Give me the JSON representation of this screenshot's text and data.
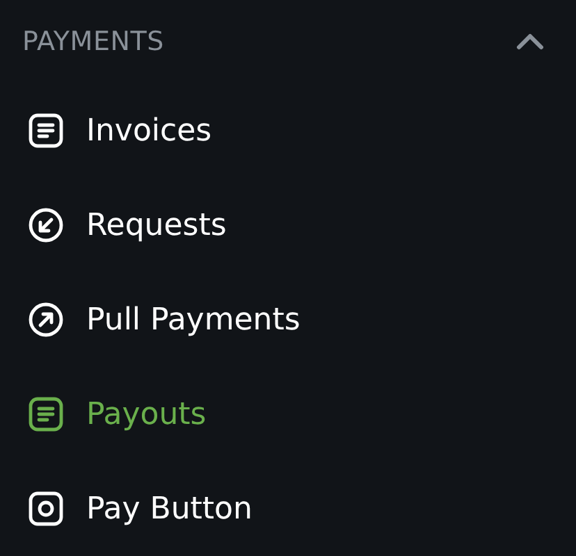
{
  "section": {
    "title": "PAYMENTS",
    "expanded": true
  },
  "items": [
    {
      "label": "Invoices",
      "kind": "document",
      "selected": false
    },
    {
      "label": "Requests",
      "kind": "arrow-in",
      "selected": false
    },
    {
      "label": "Pull Payments",
      "kind": "arrow-out",
      "selected": false
    },
    {
      "label": "Payouts",
      "kind": "document",
      "selected": true
    },
    {
      "label": "Pay Button",
      "kind": "button",
      "selected": false
    }
  ]
}
